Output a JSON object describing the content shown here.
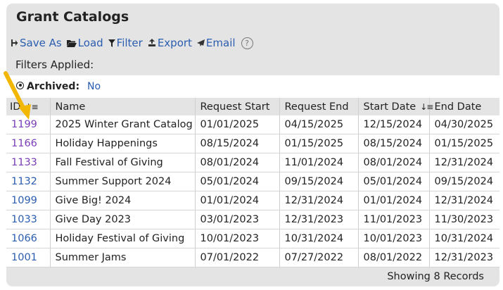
{
  "title": "Grant Catalogs",
  "toolbar": {
    "save_as": "Save As",
    "load": "Load",
    "filter": "Filter",
    "export": "Export",
    "email": "Email",
    "help": "?"
  },
  "filters": {
    "label": "Filters Applied:",
    "items": [
      {
        "key": "Archived:",
        "value": "No"
      }
    ]
  },
  "table": {
    "columns": [
      "ID",
      "Name",
      "Request Start",
      "Request End",
      "Start Date",
      "End Date"
    ],
    "sorted_columns": [
      "ID",
      "Start Date"
    ],
    "rows": [
      {
        "id": "1199",
        "name": "2025 Winter Grant Catalog",
        "request_start": "01/01/2025",
        "request_end": "04/15/2025",
        "start_date": "12/15/2024",
        "end_date": "04/30/2025",
        "visited": true
      },
      {
        "id": "1166",
        "name": "Holiday Happenings",
        "request_start": "08/15/2024",
        "request_end": "01/15/2025",
        "start_date": "08/15/2024",
        "end_date": "01/15/2025",
        "visited": true
      },
      {
        "id": "1133",
        "name": "Fall Festival of Giving",
        "request_start": "08/01/2024",
        "request_end": "11/01/2024",
        "start_date": "08/01/2024",
        "end_date": "12/31/2024",
        "visited": true
      },
      {
        "id": "1132",
        "name": "Summer Support 2024",
        "request_start": "05/01/2024",
        "request_end": "09/15/2024",
        "start_date": "05/01/2024",
        "end_date": "09/15/2024",
        "visited": false
      },
      {
        "id": "1099",
        "name": "Give Big! 2024",
        "request_start": "01/01/2024",
        "request_end": "12/31/2024",
        "start_date": "01/01/2024",
        "end_date": "12/31/2024",
        "visited": false
      },
      {
        "id": "1033",
        "name": "Give Day 2023",
        "request_start": "03/01/2023",
        "request_end": "12/31/2023",
        "start_date": "11/01/2023",
        "end_date": "11/30/2023",
        "visited": false
      },
      {
        "id": "1066",
        "name": "Holiday Festival of Giving",
        "request_start": "10/01/2023",
        "request_end": "10/31/2024",
        "start_date": "10/01/2023",
        "end_date": "10/31/2024",
        "visited": false
      },
      {
        "id": "1001",
        "name": "Summer Jams",
        "request_start": "07/01/2022",
        "request_end": "07/27/2022",
        "start_date": "08/01/2022",
        "end_date": "12/31/2023",
        "visited": false
      }
    ]
  },
  "footer": {
    "records": "Showing 8 Records"
  },
  "colors": {
    "link": "#2a5db0",
    "visited_link": "#7a3db8",
    "panel_bg": "#e4e4e4",
    "annotation_arrow": "#f2b705"
  }
}
